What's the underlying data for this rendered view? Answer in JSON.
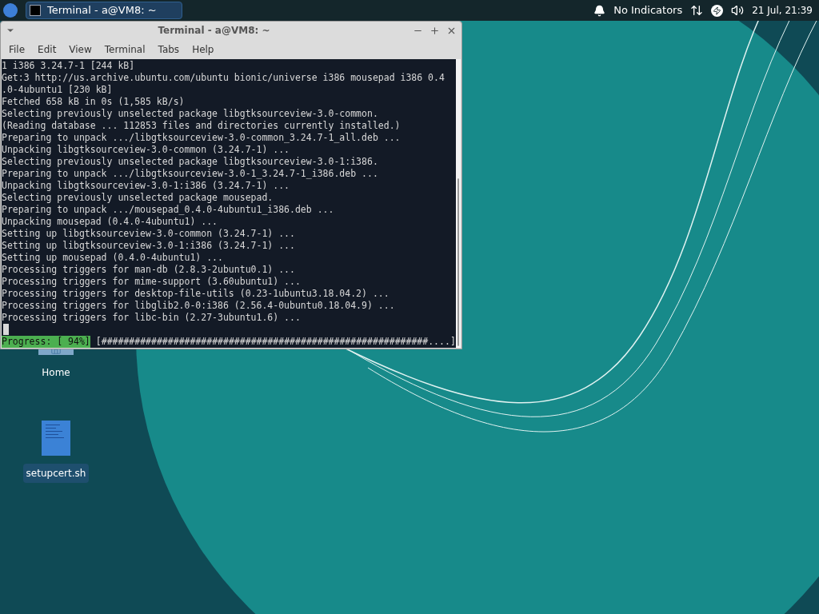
{
  "panel": {
    "tasks": [
      {
        "label": "Terminal - a@VM8: ~",
        "selected": true
      }
    ],
    "indicators_label": "No Indicators",
    "clock": "21 Jul, 21:39"
  },
  "window": {
    "title": "Terminal - a@VM8: ~",
    "menu": [
      "File",
      "Edit",
      "View",
      "Terminal",
      "Tabs",
      "Help"
    ],
    "lines": [
      "1 i386 3.24.7-1 [244 kB]",
      "Get:3 http://us.archive.ubuntu.com/ubuntu bionic/universe i386 mousepad i386 0.4",
      ".0-4ubuntu1 [230 kB]",
      "Fetched 658 kB in 0s (1,585 kB/s)",
      "Selecting previously unselected package libgtksourceview-3.0-common.",
      "(Reading database ... 112853 files and directories currently installed.)",
      "Preparing to unpack .../libgtksourceview-3.0-common_3.24.7-1_all.deb ...",
      "Unpacking libgtksourceview-3.0-common (3.24.7-1) ...",
      "Selecting previously unselected package libgtksourceview-3.0-1:i386.",
      "Preparing to unpack .../libgtksourceview-3.0-1_3.24.7-1_i386.deb ...",
      "Unpacking libgtksourceview-3.0-1:i386 (3.24.7-1) ...",
      "Selecting previously unselected package mousepad.",
      "Preparing to unpack .../mousepad_0.4.0-4ubuntu1_i386.deb ...",
      "Unpacking mousepad (0.4.0-4ubuntu1) ...",
      "Setting up libgtksourceview-3.0-common (3.24.7-1) ...",
      "Setting up libgtksourceview-3.0-1:i386 (3.24.7-1) ...",
      "Setting up mousepad (0.4.0-4ubuntu1) ...",
      "Processing triggers for man-db (2.8.3-2ubuntu0.1) ...",
      "Processing triggers for mime-support (3.60ubuntu1) ...",
      "Processing triggers for desktop-file-utils (0.23-1ubuntu3.18.04.2) ...",
      "Processing triggers for libglib2.0-0:i386 (2.56.4-0ubuntu0.18.04.9) ...",
      "Processing triggers for libc-bin (2.27-3ubuntu1.6) ..."
    ],
    "progress_label": "Progress: [ 94%]",
    "progress_bar": "[###########################################################....]"
  },
  "desktop_icons": [
    {
      "kind": "folder",
      "label": "Home",
      "selected": false
    },
    {
      "kind": "file",
      "label": "setupcert.sh",
      "selected": true
    }
  ]
}
